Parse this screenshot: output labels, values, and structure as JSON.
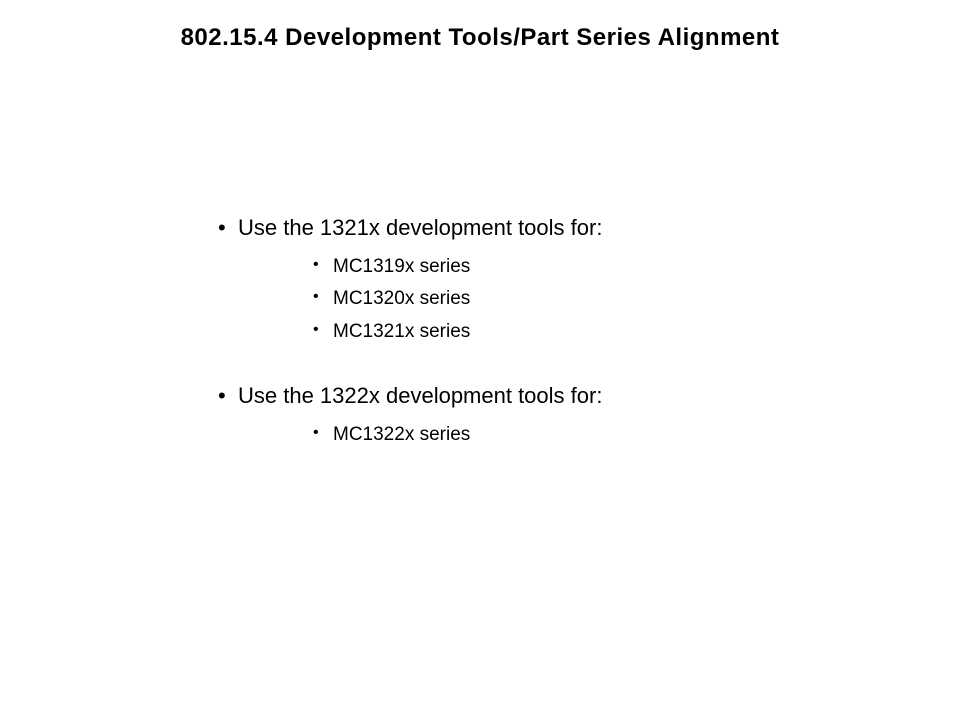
{
  "title": "802.15.4 Development Tools/Part Series Alignment",
  "sections": [
    {
      "heading": "Use the 1321x development tools for:",
      "items": [
        "MC1319x series",
        "MC1320x series",
        "MC1321x series"
      ]
    },
    {
      "heading": "Use the 1322x development tools for:",
      "items": [
        "MC1322x series"
      ]
    }
  ]
}
